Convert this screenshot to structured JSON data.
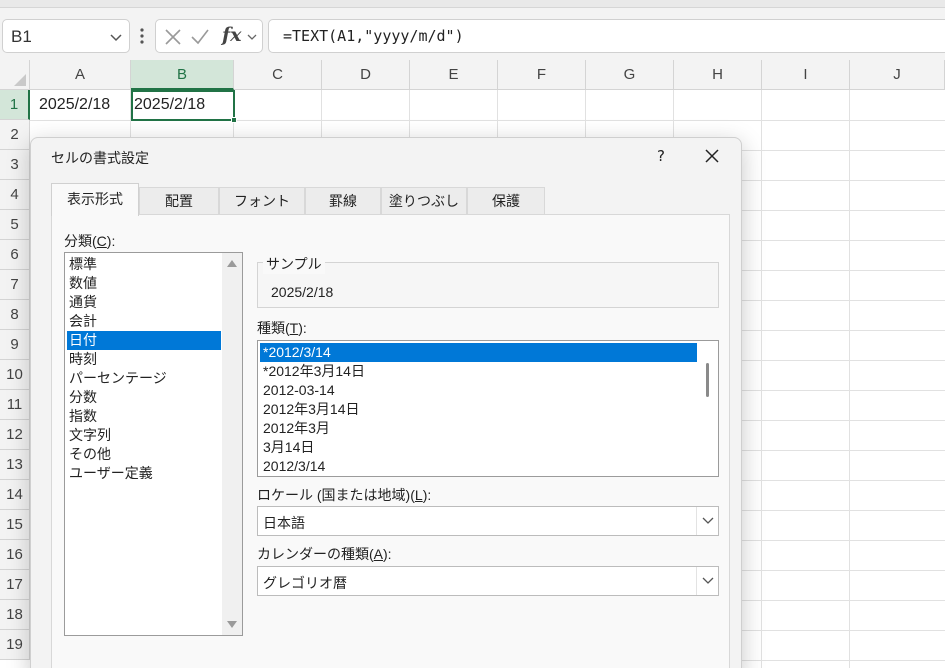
{
  "formula_bar": {
    "name_box": "B1",
    "fx_label": "fx",
    "formula": "=TEXT(A1,\"yyyy/m/d\")"
  },
  "grid": {
    "columns": [
      "A",
      "B",
      "C",
      "D",
      "E",
      "F",
      "G",
      "H",
      "I",
      "J"
    ],
    "selected_column": "B",
    "rows": [
      "1",
      "2",
      "3",
      "4",
      "5",
      "6",
      "7",
      "8",
      "9",
      "10",
      "11",
      "12",
      "13",
      "14",
      "15",
      "16",
      "17",
      "18",
      "19"
    ],
    "selected_row": "1",
    "cells": {
      "A1": "2025/2/18",
      "B1": "2025/2/18"
    },
    "active_cell": "B1"
  },
  "dialog": {
    "title": "セルの書式設定",
    "help_label": "?",
    "tabs": [
      "表示形式",
      "配置",
      "フォント",
      "罫線",
      "塗りつぶし",
      "保護"
    ],
    "active_tab": "表示形式",
    "category_label": "分類(",
    "category_label_key": "C",
    "category_label_end": "):",
    "categories": [
      "標準",
      "数値",
      "通貨",
      "会計",
      "日付",
      "時刻",
      "パーセンテージ",
      "分数",
      "指数",
      "文字列",
      "その他",
      "ユーザー定義"
    ],
    "selected_category": "日付",
    "sample_label": "サンプル",
    "sample_value": "2025/2/18",
    "type_label": "種類(",
    "type_label_key": "T",
    "type_label_end": "):",
    "types": [
      "*2012/3/14",
      "*2012年3月14日",
      "2012-03-14",
      "2012年3月14日",
      "2012年3月",
      "3月14日",
      "2012/3/14"
    ],
    "selected_type": "*2012/3/14",
    "locale_label": "ロケール (国または地域)(",
    "locale_label_key": "L",
    "locale_label_end": "):",
    "locale_value": "日本語",
    "calendar_label": "カレンダーの種類(",
    "calendar_label_key": "A",
    "calendar_label_end": "):",
    "calendar_value": "グレゴリオ暦"
  },
  "colors": {
    "selection_blue": "#0078d7",
    "excel_green": "#217346",
    "header_selected_bg": "#d3e6d9"
  }
}
